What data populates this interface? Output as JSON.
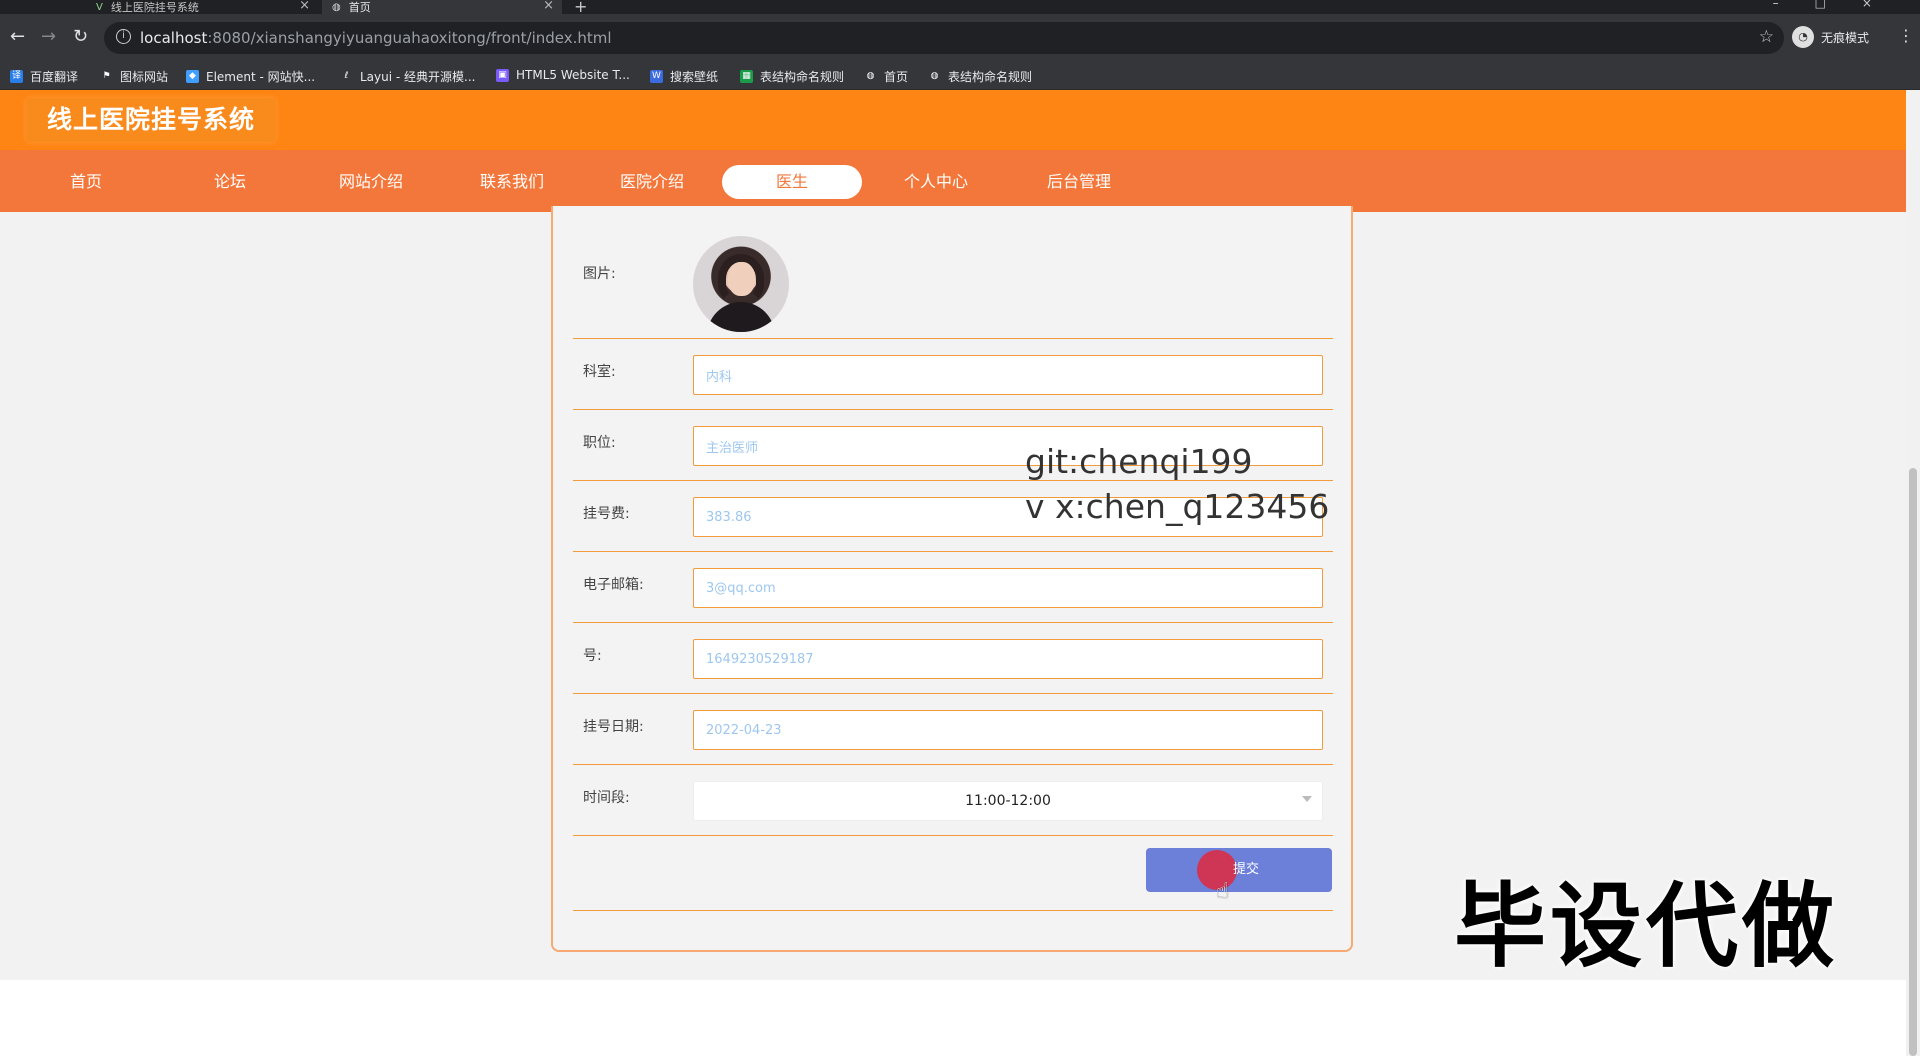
{
  "browser": {
    "tabs": [
      {
        "title": "线上医院挂号系统",
        "active": false
      },
      {
        "title": "首页",
        "active": true
      }
    ],
    "url_host": "localhost",
    "url_rest": ":8080/xianshangyiyuanguahaoxitong/front/index.html",
    "incognito_label": "无痕模式",
    "bookmarks": [
      "百度翻译",
      "图标网站",
      "Element - 网站快...",
      "Layui - 经典开源模...",
      "HTML5 Website T...",
      "搜索壁纸",
      "表结构命名规则",
      "首页",
      "表结构命名规则"
    ]
  },
  "site": {
    "title": "线上医院挂号系统",
    "nav": [
      "首页",
      "论坛",
      "网站介绍",
      "联系我们",
      "医院介绍",
      "医生",
      "个人中心",
      "后台管理"
    ],
    "active_nav": "医生"
  },
  "form": {
    "picture_label": "图片:",
    "fields": [
      {
        "label": "科室:",
        "value": "内科"
      },
      {
        "label": "职位:",
        "value": "主治医师"
      },
      {
        "label": "挂号费:",
        "value": "383.86"
      },
      {
        "label": "电子邮箱:",
        "value": "3@qq.com"
      },
      {
        "label": "号:",
        "value": "1649230529187"
      },
      {
        "label": "挂号日期:",
        "value": "2022-04-23"
      }
    ],
    "time_label": "时间段:",
    "time_value": "11:00-12:00",
    "submit_label": "提交"
  },
  "overlay": {
    "git": "git:chenqi199",
    "vx": "v x:chen_q123456",
    "promo": "毕设代做"
  },
  "colors": {
    "header": "#fe8413",
    "navbar": "#f3773a",
    "field_border": "#f39a3c",
    "submit": "#6c7fd9"
  }
}
